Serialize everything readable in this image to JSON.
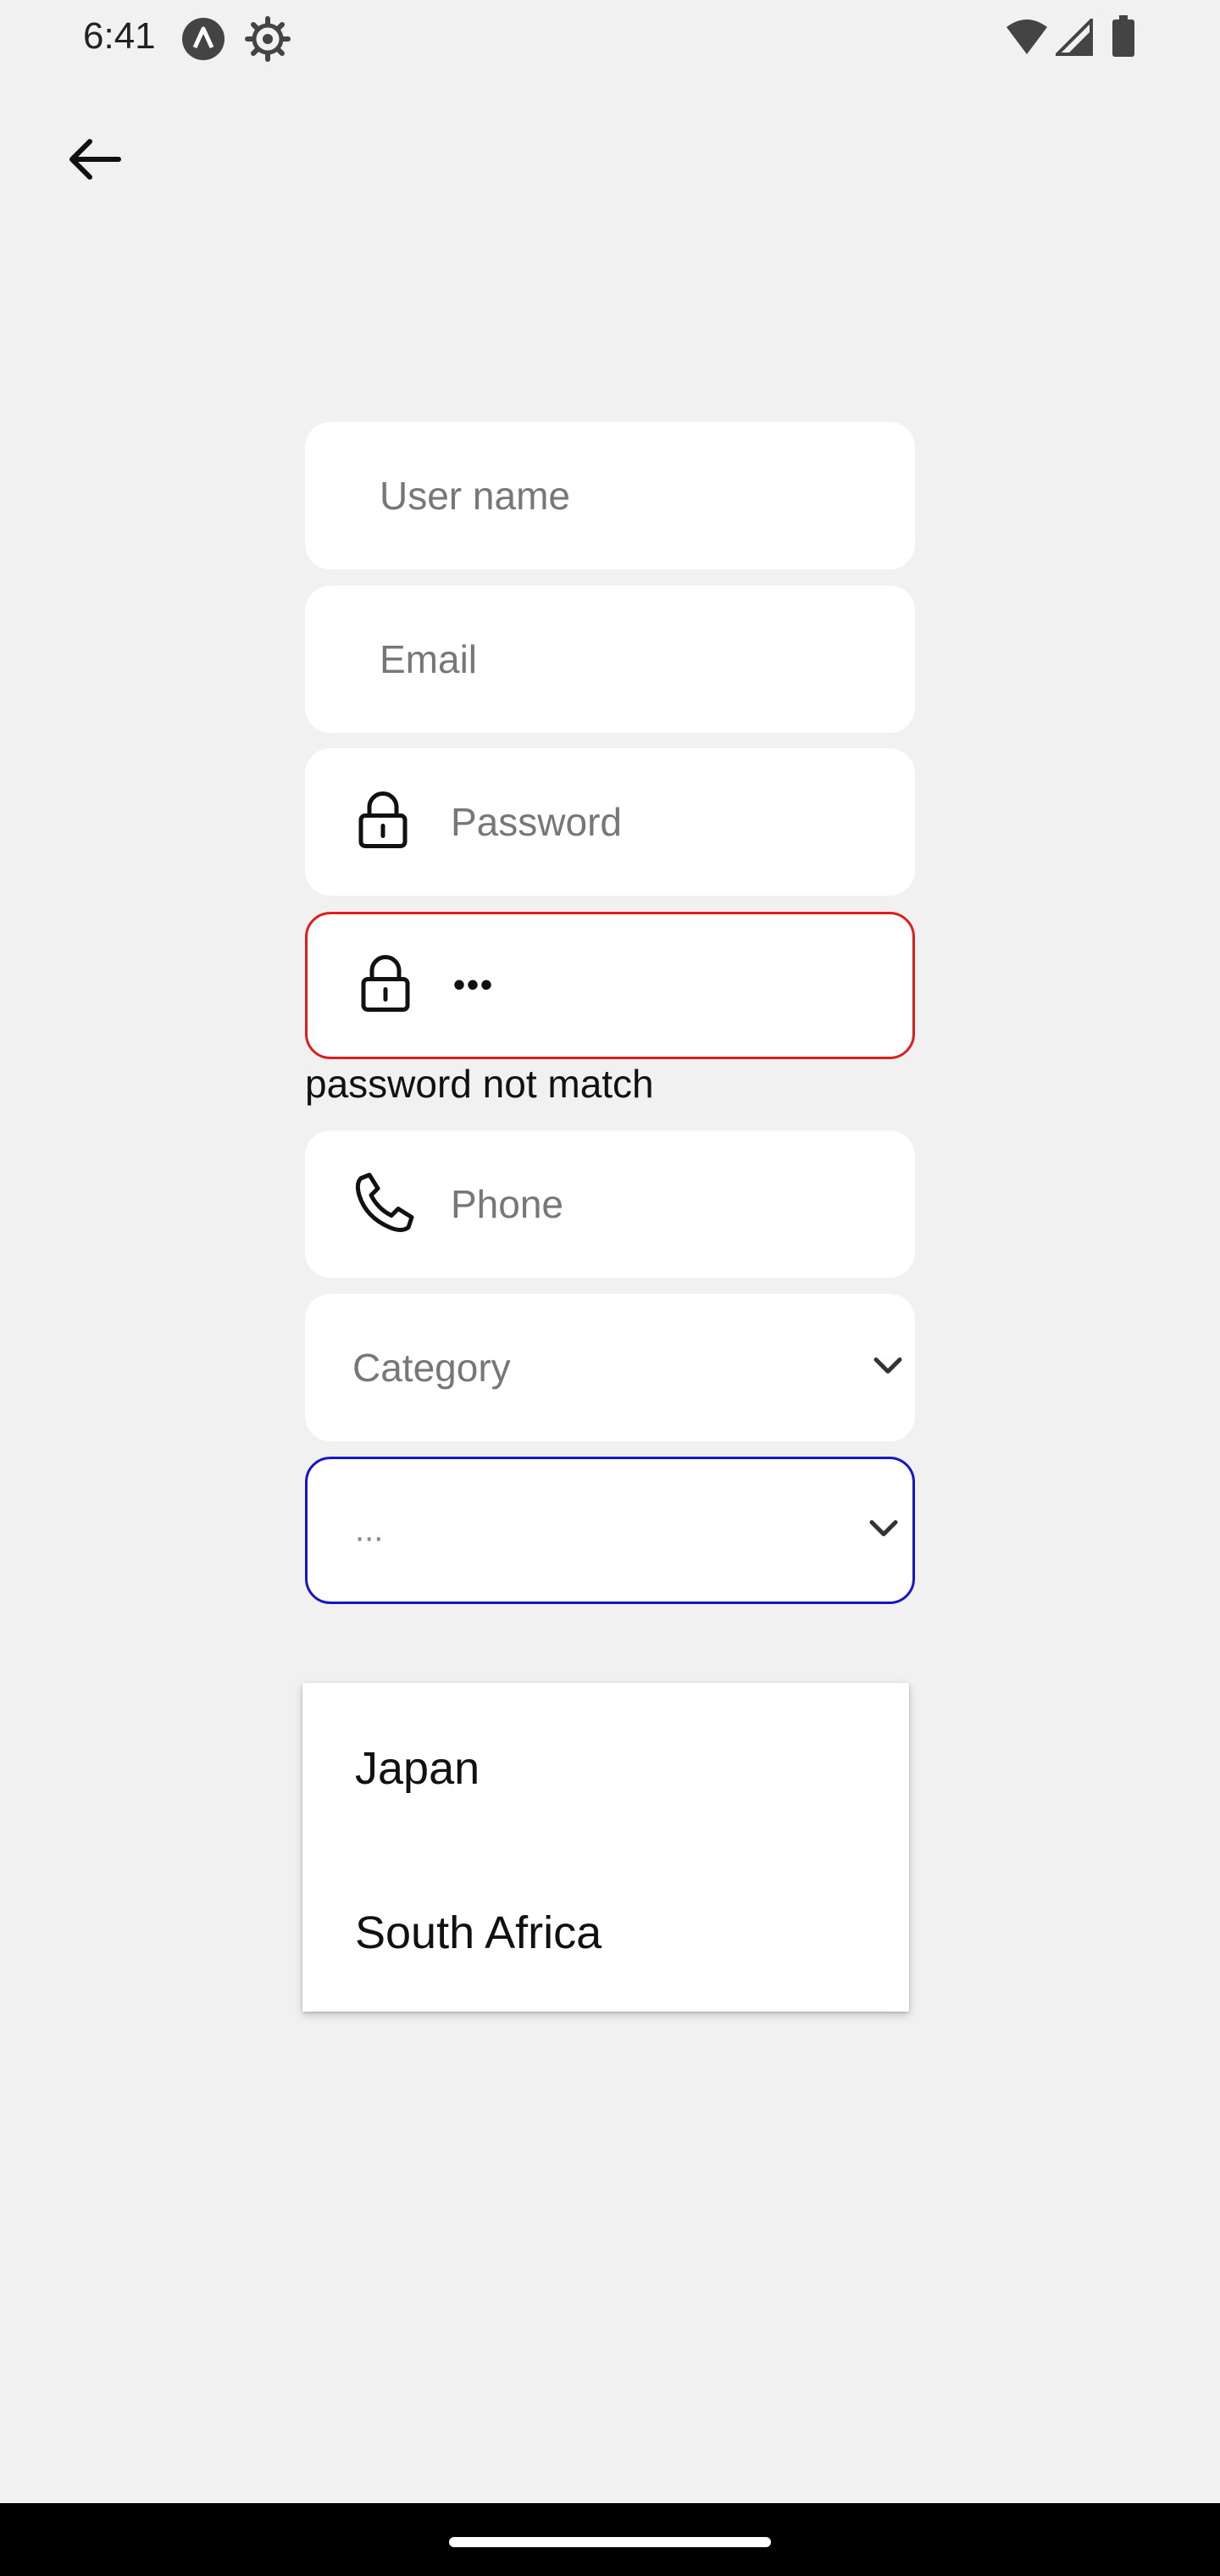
{
  "status_bar": {
    "time": "6:41",
    "icons": [
      "app-badge-icon",
      "settings-gear-icon",
      "wifi-icon",
      "signal-icon",
      "battery-icon"
    ]
  },
  "navigation": {
    "back_icon": "arrow-left-icon"
  },
  "form": {
    "username_placeholder": "User name",
    "email_placeholder": "Email",
    "password_placeholder": "Password",
    "confirm_password_value": "•••",
    "confirm_password_error": "password not match",
    "phone_placeholder": "Phone",
    "category_placeholder": "Category",
    "country_value": "..."
  },
  "dropdown": {
    "options": [
      "Japan",
      "South Africa"
    ]
  },
  "colors": {
    "background": "#f1f1f1",
    "error_border": "#e01e1e",
    "focus_border": "#1616c8"
  }
}
